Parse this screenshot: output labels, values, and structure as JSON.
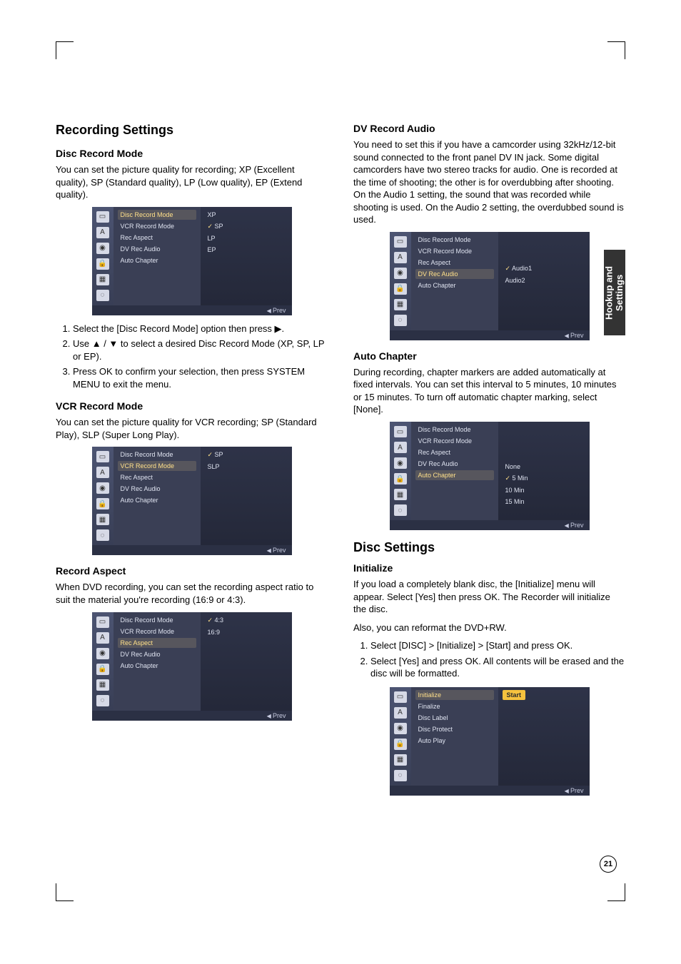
{
  "sidetab": "Hookup and Settings",
  "page_number": "21",
  "shot_footer": "Prev",
  "col_left": {
    "recording_settings": {
      "title": "Recording Settings",
      "disc_record_mode": {
        "heading": "Disc Record Mode",
        "body": "You can set the picture quality for recording; XP (Excellent quality), SP (Standard quality), LP (Low quality), EP (Extend quality).",
        "steps": [
          "Select the [Disc Record Mode] option then press ▶.",
          "Use ▲ / ▼ to select a desired Disc Record Mode (XP, SP, LP or EP).",
          "Press OK to confirm your selection, then press SYSTEM MENU to exit the menu."
        ],
        "shot": {
          "mid": [
            "Disc Record Mode",
            "VCR Record Mode",
            "Rec Aspect",
            "DV Rec Audio",
            "Auto Chapter"
          ],
          "mid_hi_index": 0,
          "right": [
            "XP",
            "SP",
            "LP",
            "EP"
          ],
          "right_checked_index": 1
        }
      },
      "vcr_record_mode": {
        "heading": "VCR Record Mode",
        "body": "You can set the picture quality for VCR recording; SP (Standard Play), SLP (Super Long Play).",
        "shot": {
          "mid": [
            "Disc Record Mode",
            "VCR Record Mode",
            "Rec Aspect",
            "DV Rec Audio",
            "Auto Chapter"
          ],
          "mid_hi_index": 1,
          "right": [
            "SP",
            "SLP"
          ],
          "right_checked_index": 0
        }
      },
      "record_aspect": {
        "heading": "Record Aspect",
        "body": "When DVD recording, you can set the recording aspect ratio to suit the material you're recording (16:9 or 4:3).",
        "shot": {
          "mid": [
            "Disc Record Mode",
            "VCR Record Mode",
            "Rec Aspect",
            "DV Rec Audio",
            "Auto Chapter"
          ],
          "mid_hi_index": 2,
          "right": [
            "4:3",
            "16:9"
          ],
          "right_checked_index": 0
        }
      }
    }
  },
  "col_right": {
    "dv_record_audio": {
      "heading": "DV Record Audio",
      "body": "You need to set this if you have a camcorder using 32kHz/12-bit sound connected to the front panel DV IN jack. Some digital camcorders have two stereo tracks for audio. One is recorded at the time of shooting; the other is for overdubbing after shooting. On the Audio 1 setting, the sound that was recorded while shooting is used. On the Audio 2 setting, the overdubbed sound is used.",
      "shot": {
        "mid": [
          "Disc Record Mode",
          "VCR Record Mode",
          "Rec Aspect",
          "DV Rec Audio",
          "Auto Chapter"
        ],
        "mid_hi_index": 3,
        "right": [
          "Audio1",
          "Audio2"
        ],
        "right_checked_index": 0
      }
    },
    "auto_chapter": {
      "heading": "Auto Chapter",
      "body": "During recording, chapter markers are added automatically at fixed intervals. You can set this interval to 5 minutes, 10 minutes or 15 minutes. To turn off automatic chapter marking, select [None].",
      "shot": {
        "mid": [
          "Disc Record Mode",
          "VCR Record Mode",
          "Rec Aspect",
          "DV Rec Audio",
          "Auto Chapter"
        ],
        "mid_hi_index": 4,
        "right": [
          "None",
          "5 Min",
          "10 Min",
          "15 Min"
        ],
        "right_checked_index": 1
      }
    },
    "disc_settings": {
      "title": "Disc Settings",
      "initialize": {
        "heading": "Initialize",
        "body1": "If you load a completely blank disc, the [Initialize] menu will appear. Select [Yes] then press OK. The Recorder will initialize the disc.",
        "body2": "Also, you can reformat the DVD+RW.",
        "steps": [
          "Select [DISC] > [Initialize] > [Start] and press OK.",
          "Select [Yes] and press OK. All contents will be erased and the disc will be formatted."
        ],
        "shot": {
          "mid": [
            "Initialize",
            "Finalize",
            "Disc Label",
            "Disc Protect",
            "Auto Play"
          ],
          "mid_hi_index": 0,
          "right_button": "Start"
        }
      }
    }
  },
  "tab_icons": [
    "▭",
    "A",
    "◉",
    "🔒",
    "▦",
    "◌"
  ]
}
